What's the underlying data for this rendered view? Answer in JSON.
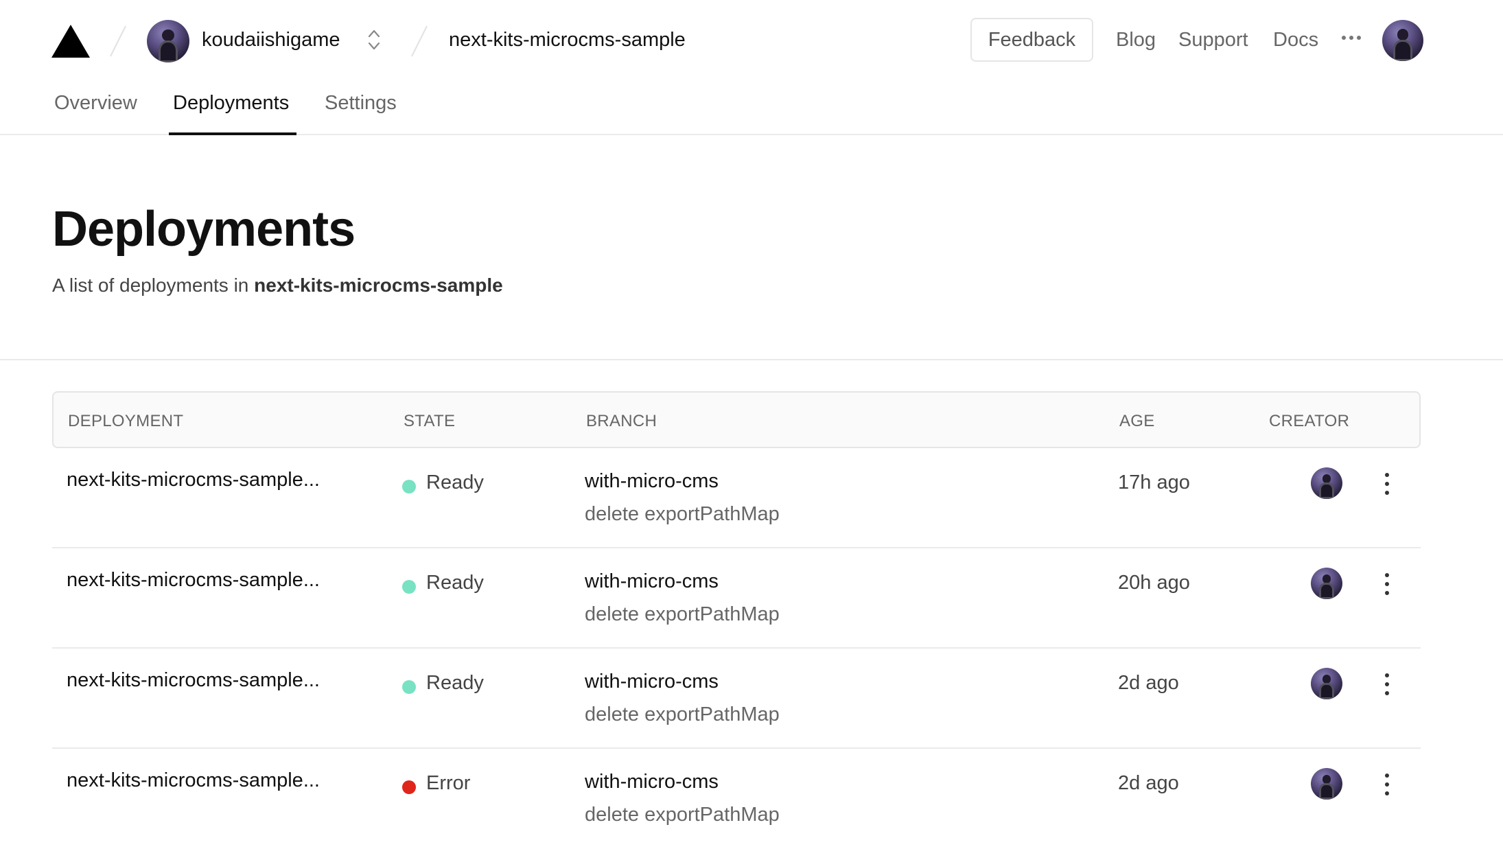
{
  "header": {
    "team_name": "koudaiishigame",
    "project_name": "next-kits-microcms-sample",
    "feedback_label": "Feedback",
    "links": [
      "Blog",
      "Support",
      "Docs"
    ]
  },
  "tabs": [
    {
      "label": "Overview",
      "active": false
    },
    {
      "label": "Deployments",
      "active": true
    },
    {
      "label": "Settings",
      "active": false
    }
  ],
  "page": {
    "title": "Deployments",
    "subtitle_prefix": "A list of deployments in ",
    "subtitle_project": "next-kits-microcms-sample"
  },
  "table": {
    "columns": [
      "DEPLOYMENT",
      "STATE",
      "BRANCH",
      "AGE",
      "CREATOR"
    ],
    "rows": [
      {
        "name": "next-kits-microcms-sample...",
        "state": "Ready",
        "state_color": "#79e2c2",
        "branch": "with-micro-cms",
        "commit": "delete exportPathMap",
        "age": "17h ago"
      },
      {
        "name": "next-kits-microcms-sample...",
        "state": "Ready",
        "state_color": "#79e2c2",
        "branch": "with-micro-cms",
        "commit": "delete exportPathMap",
        "age": "20h ago"
      },
      {
        "name": "next-kits-microcms-sample...",
        "state": "Ready",
        "state_color": "#79e2c2",
        "branch": "with-micro-cms",
        "commit": "delete exportPathMap",
        "age": "2d ago"
      },
      {
        "name": "next-kits-microcms-sample...",
        "state": "Error",
        "state_color": "#e0251b",
        "branch": "with-micro-cms",
        "commit": "delete exportPathMap",
        "age": "2d ago"
      }
    ]
  },
  "icons": {
    "logo": "vercel-triangle-icon",
    "team_switcher": "chevron-up-down-icon",
    "more": "ellipsis-icon",
    "row_menu": "kebab-menu-icon"
  }
}
